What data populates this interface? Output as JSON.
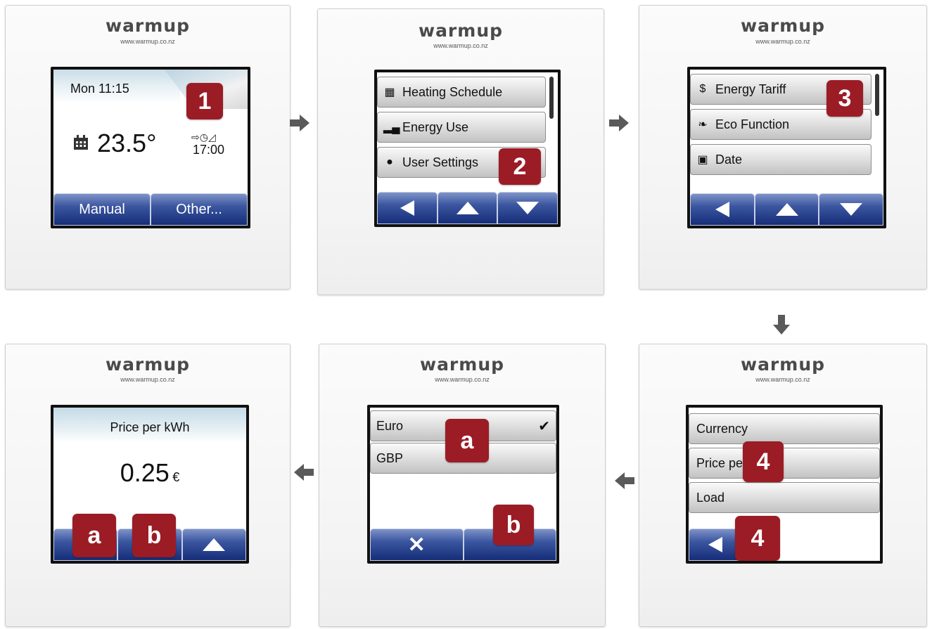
{
  "brand": {
    "name": "warmup",
    "url": "www.warmup.co.nz"
  },
  "panel1": {
    "day_time": "Mon 11:15",
    "temperature": "23.5°",
    "schedule_time": "17:00",
    "buttons": [
      "Manual",
      "Other..."
    ],
    "badge": "1"
  },
  "panel2": {
    "menu": [
      "Heating Schedule",
      "Energy Use",
      "User Settings"
    ],
    "icons": [
      "calendar-icon",
      "bar-chart-icon",
      "user-icon"
    ],
    "badge": "2"
  },
  "panel3": {
    "menu": [
      "Energy Tariff",
      "Eco Function",
      "Date"
    ],
    "icons": [
      "dollar-coin-icon",
      "leaf-icon",
      "calendar-date-icon"
    ],
    "badge": "3"
  },
  "panel4": {
    "menu": [
      "Currency",
      "Price per",
      "Load"
    ],
    "badge_menu": "4",
    "badge_back": "4"
  },
  "panel5": {
    "options": [
      "Euro",
      "GBP"
    ],
    "badge_a": "a",
    "badge_b": "b"
  },
  "panel6": {
    "title": "Price per kWh",
    "value": "0.25",
    "unit": "€",
    "badge_a": "a",
    "badge_b": "b"
  },
  "colors": {
    "badge": "#9b1c25",
    "button_blue": "#1c3a8a",
    "arrow_gray": "#5a5a5a"
  }
}
